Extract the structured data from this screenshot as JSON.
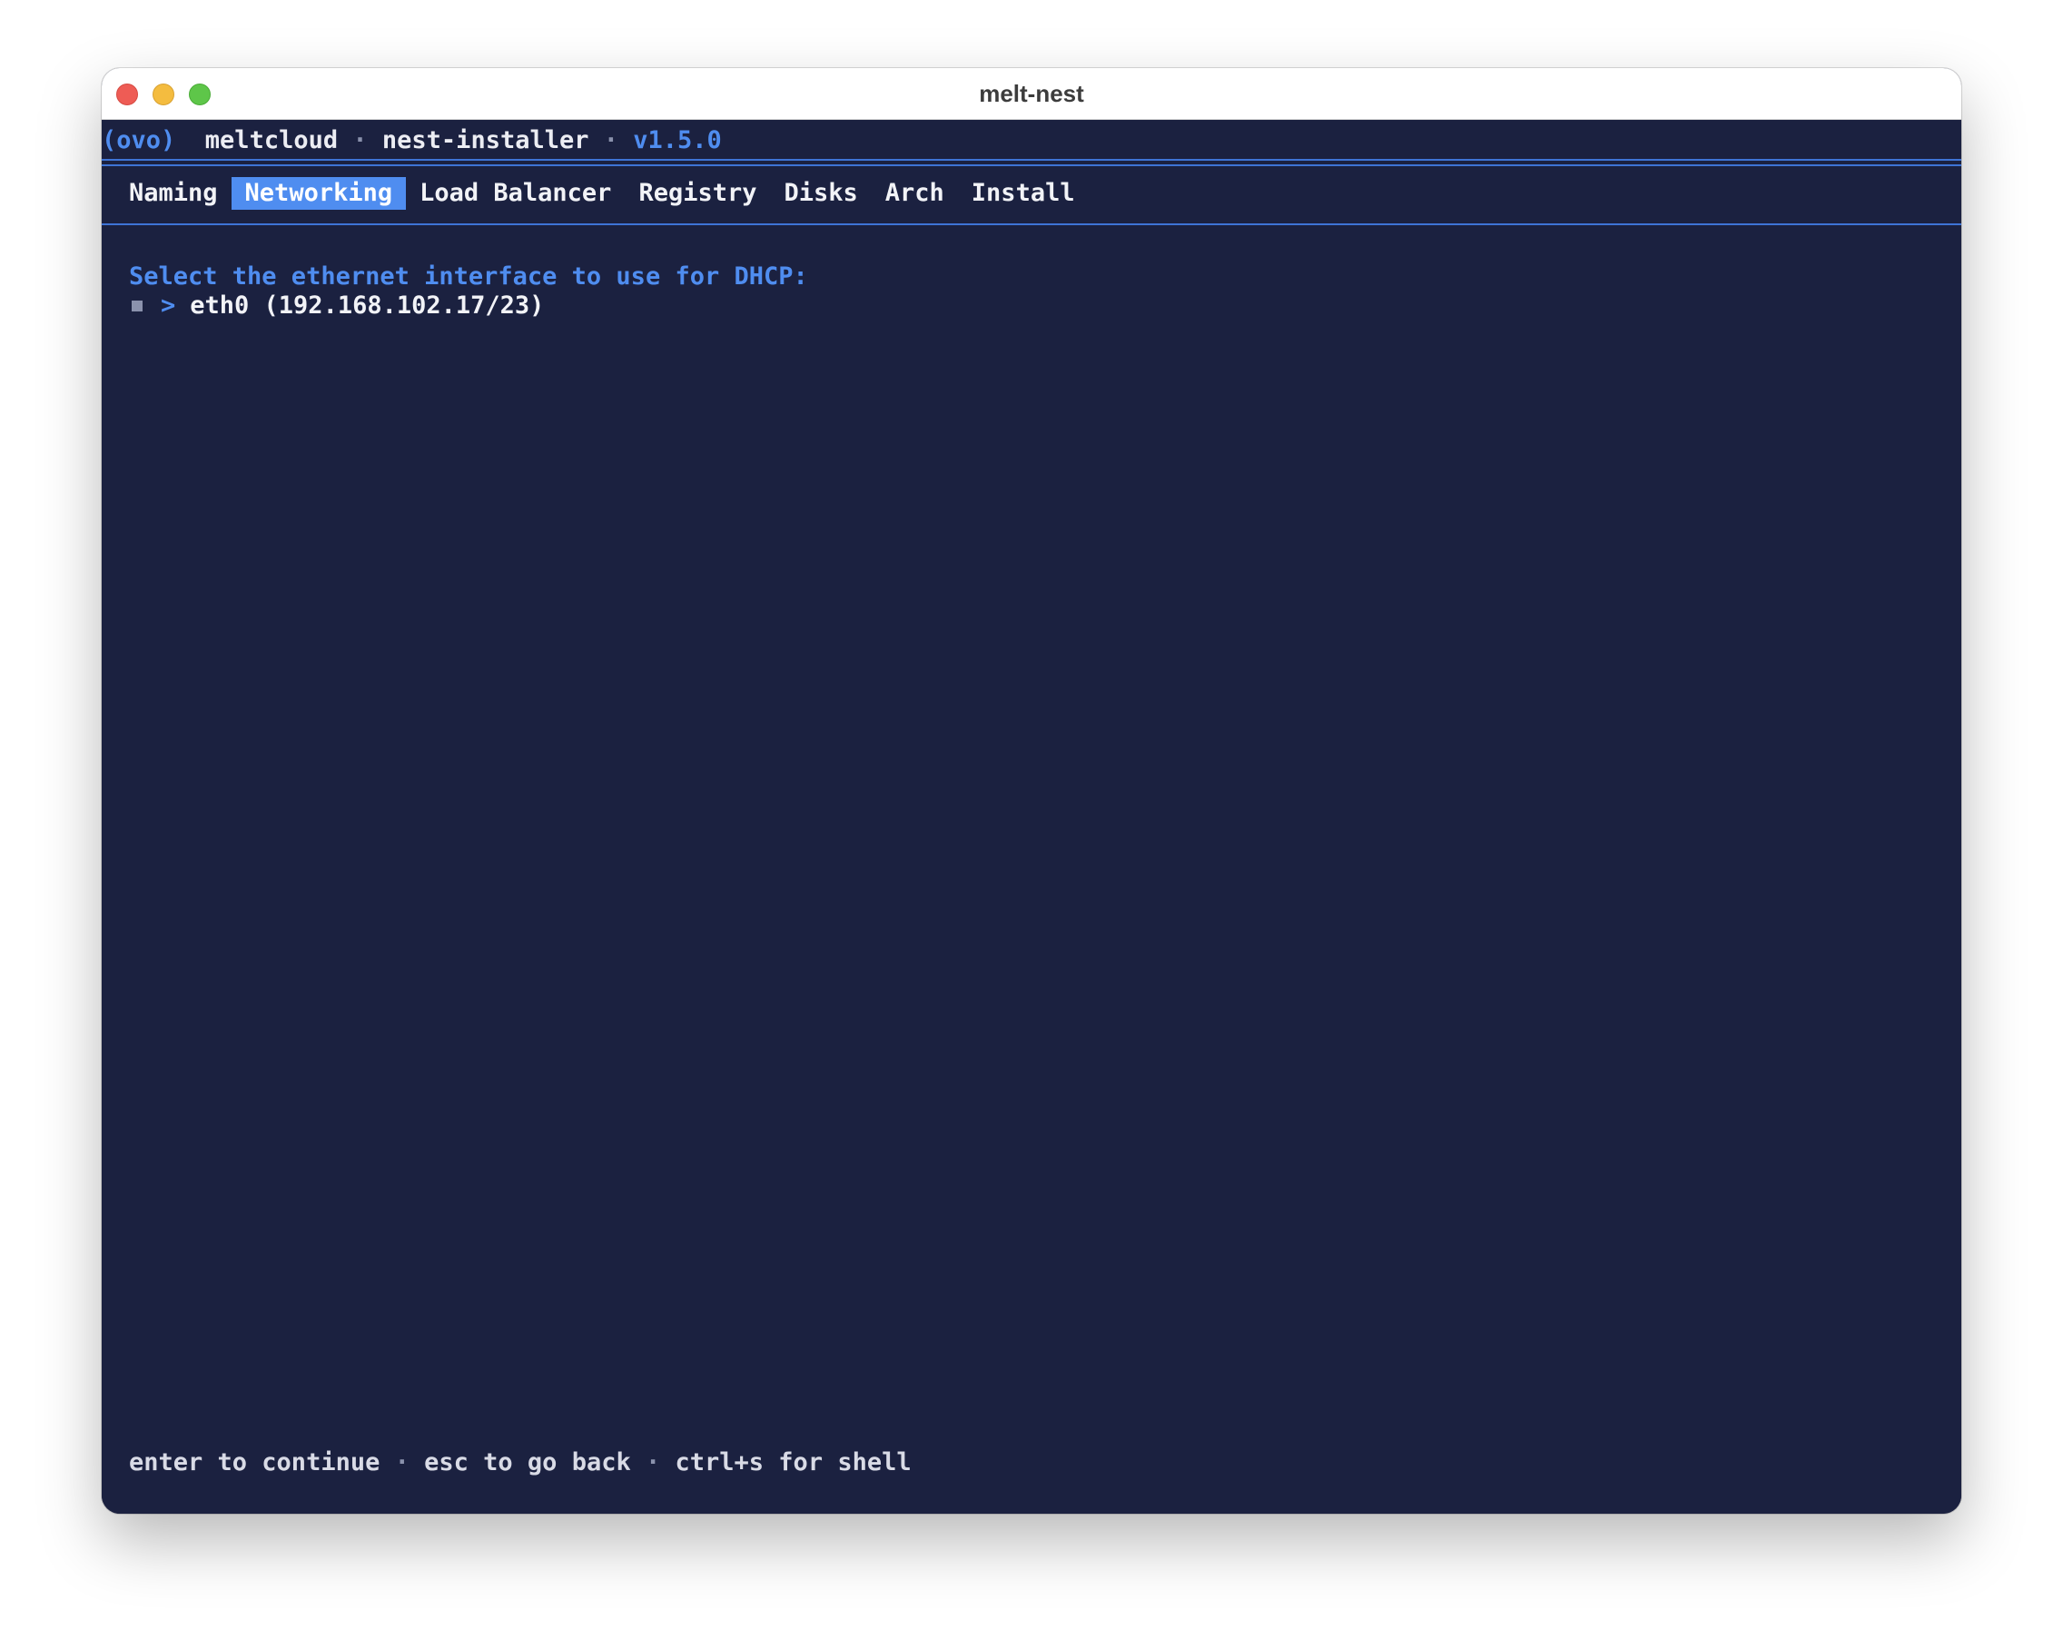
{
  "window": {
    "title": "melt-nest"
  },
  "header": {
    "logo": "(ovo)",
    "brand": "meltcloud",
    "separator": "·",
    "app": "nest-installer",
    "version": "v1.5.0"
  },
  "tabs": [
    {
      "label": "Naming",
      "active": false
    },
    {
      "label": "Networking",
      "active": true
    },
    {
      "label": "Load Balancer",
      "active": false
    },
    {
      "label": "Registry",
      "active": false
    },
    {
      "label": "Disks",
      "active": false
    },
    {
      "label": "Arch",
      "active": false
    },
    {
      "label": "Install",
      "active": false
    }
  ],
  "main": {
    "prompt": "Select the ethernet interface to use for DHCP:",
    "options": [
      {
        "cursor": ">",
        "label": "eth0 (192.168.102.17/23)",
        "selected": true
      }
    ]
  },
  "footer": {
    "hint_continue": "enter to continue",
    "hint_back": "esc to go back",
    "hint_shell": "ctrl+s for shell",
    "separator": "·"
  },
  "colors": {
    "background": "#1b2140",
    "accent": "#4f8df0",
    "text": "#ecedf3",
    "muted": "#8b92ad"
  }
}
